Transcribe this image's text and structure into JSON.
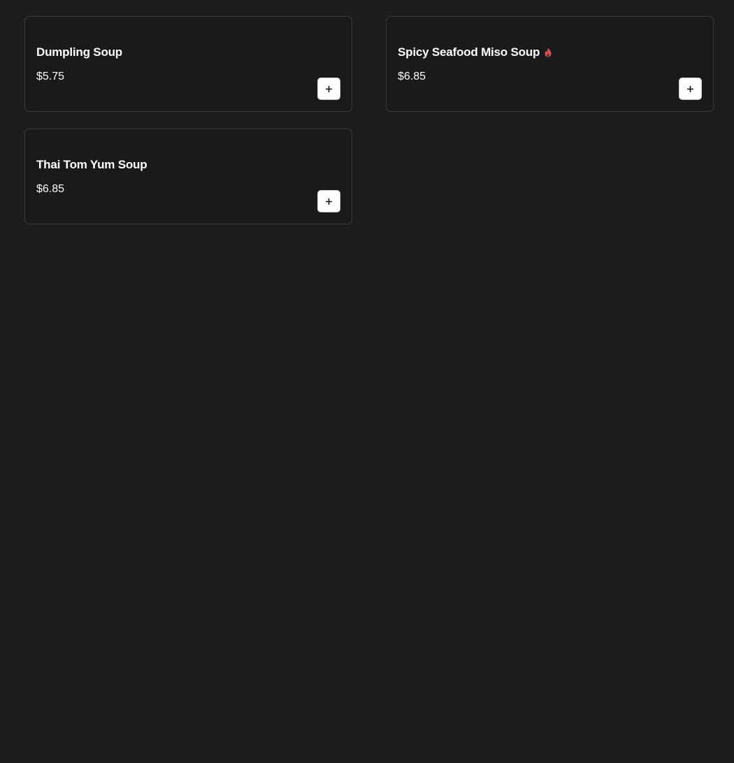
{
  "menu": {
    "items": [
      {
        "name": "Dumpling Soup",
        "price": "$5.75",
        "spicy": false
      },
      {
        "name": "Spicy Seafood Miso Soup",
        "price": "$6.85",
        "spicy": true
      },
      {
        "name": "Thai Tom Yum Soup",
        "price": "$6.85",
        "spicy": false
      }
    ]
  },
  "icons": {
    "add": "plus-icon",
    "spicy": "flame-icon"
  },
  "colors": {
    "background": "#1c1c1c",
    "card_border": "#3a3a3a",
    "text": "#ffffff",
    "spicy": "#d9534f",
    "button_bg": "#ffffff"
  }
}
